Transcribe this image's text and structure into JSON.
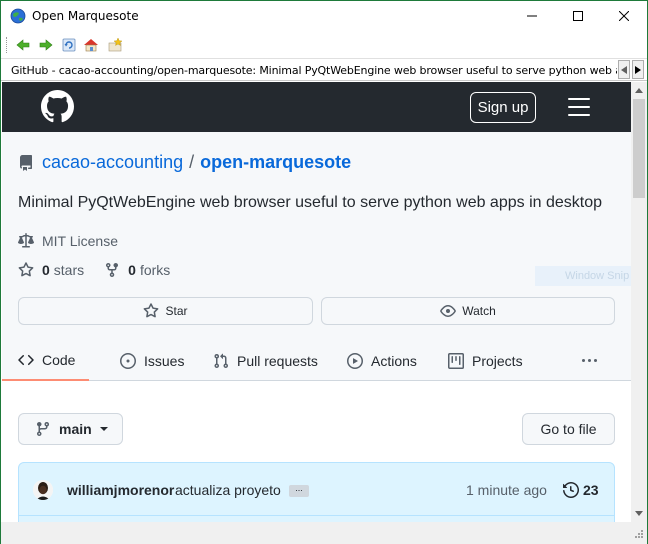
{
  "window": {
    "title": "Open Marquesote",
    "icon": "globe-icon"
  },
  "toolbar": {
    "items": [
      "back-arrow-icon",
      "forward-arrow-icon",
      "reload-icon",
      "home-icon",
      "bookmark-icon"
    ]
  },
  "address_bar": {
    "text": "GitHub - cacao-accounting/open-marquesote: Minimal PyQtWebEngine web browser useful to serve python web apps in desktop"
  },
  "header": {
    "signup_label": "Sign up"
  },
  "repo": {
    "owner": "cacao-accounting",
    "separator": "/",
    "name": "open-marquesote",
    "description": "Minimal PyQtWebEngine web browser useful to serve python web apps in desktop",
    "license": "MIT License",
    "stars_count": "0",
    "stars_label": "stars",
    "forks_count": "0",
    "forks_label": "forks",
    "star_button": "Star",
    "watch_button": "Watch"
  },
  "tabs": [
    {
      "label": "Code",
      "active": true,
      "icon": "code-icon"
    },
    {
      "label": "Issues",
      "active": false,
      "icon": "issue-icon"
    },
    {
      "label": "Pull requests",
      "active": false,
      "icon": "pull-request-icon"
    },
    {
      "label": "Actions",
      "active": false,
      "icon": "play-icon"
    },
    {
      "label": "Projects",
      "active": false,
      "icon": "project-icon"
    }
  ],
  "code": {
    "branch": "main",
    "go_to_file": "Go to file",
    "commit": {
      "author": "williamjmorenor",
      "message": "actualiza proyeto",
      "dots": "...",
      "time": "1 minute ago",
      "count": "23"
    }
  },
  "overlay": {
    "watermark": "Window Snip"
  },
  "colors": {
    "accent_link": "#0969da",
    "header_bg": "#24292f",
    "tab_underline": "#fd8c73",
    "commit_bg": "#ddf4ff",
    "window_border": "#1e7a3a"
  }
}
